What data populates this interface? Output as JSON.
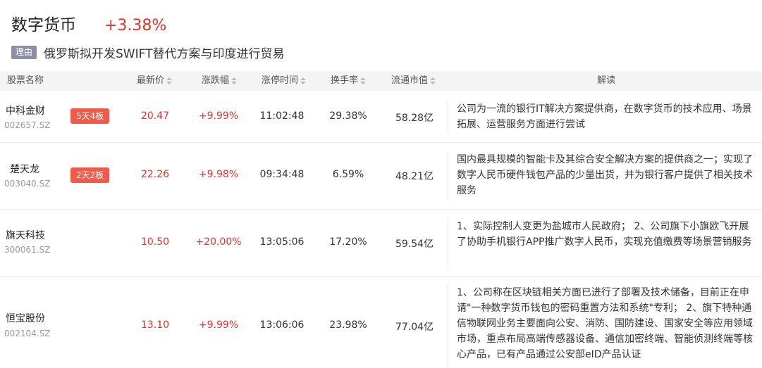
{
  "header": {
    "sector": "数字货币",
    "change": "+3.38%",
    "reason_tag": "理由",
    "reason": "俄罗斯拟开发SWIFT替代方案与印度进行贸易"
  },
  "columns": {
    "name": "股票名称",
    "price": "最新价",
    "change": "涨跌幅",
    "limit_time": "涨停时间",
    "turnover": "换手率",
    "market_cap": "流通市值",
    "explain": "解读"
  },
  "rows": [
    {
      "name": "中科金财",
      "code": "002657.SZ",
      "badge": "5天4板",
      "price": "20.47",
      "change": "+9.99%",
      "limit_time": "11:02:48",
      "turnover": "29.38%",
      "market_cap": "58.28亿",
      "explain": "公司为一流的银行IT解决方案提供商，在数字货币的技术应用、场景拓展、运营服务方面进行尝试"
    },
    {
      "name": "楚天龙",
      "code": "003040.SZ",
      "badge": "2天2板",
      "price": "22.26",
      "change": "+9.98%",
      "limit_time": "09:34:48",
      "turnover": "6.59%",
      "market_cap": "48.21亿",
      "explain": "国内最具规模的智能卡及其综合安全解决方案的提供商之一；实现了数字人民币硬件钱包产品的少量出货，并为银行客户提供了相关技术服务"
    },
    {
      "name": "旗天科技",
      "code": "300061.SZ",
      "badge": "",
      "price": "10.50",
      "change": "+20.00%",
      "limit_time": "13:05:06",
      "turnover": "17.20%",
      "market_cap": "59.54亿",
      "explain": "1、实际控制人变更为盐城市人民政府； 2、公司旗下小旗欧飞开展了协助手机银行APP推广数字人民币，实现充值缴费等场景营销服务"
    },
    {
      "name": "恒宝股份",
      "code": "002104.SZ",
      "badge": "",
      "price": "13.10",
      "change": "+9.99%",
      "limit_time": "13:06:06",
      "turnover": "23.98%",
      "market_cap": "77.04亿",
      "explain": "1、公司称在区块链相关方面已进行了部署及技术储备，目前正在申请\"一种数字货币钱包的密码重置方法和系统\"专利； 2、旗下特种通信物联网业务主要面向公安、消防、国防建设、国家安全等应用领域市场，重点布局高端传感器设备、通信加密终端、智能侦测终端等核心产品，已有产品通过公安部eID产品认证"
    }
  ]
}
